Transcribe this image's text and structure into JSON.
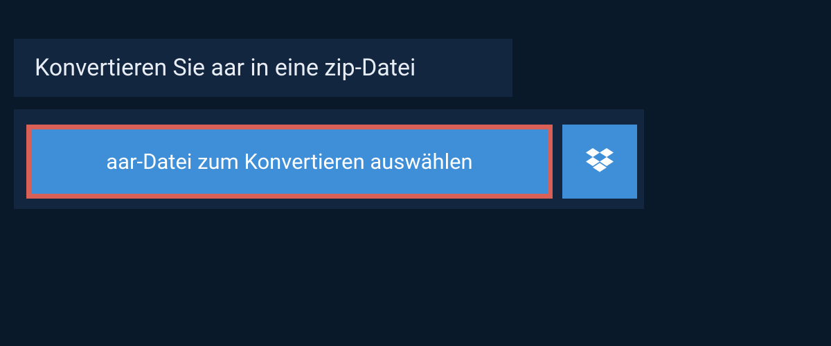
{
  "title": "Konvertieren Sie aar in eine zip-Datei",
  "buttons": {
    "select_file_label": "aar-Datei zum Konvertieren auswählen"
  },
  "colors": {
    "background": "#0a1929",
    "panel": "#12263f",
    "button": "#3e8fd8",
    "highlight_border": "#d96056",
    "text_light": "#e8edf5",
    "text_white": "#ffffff"
  }
}
